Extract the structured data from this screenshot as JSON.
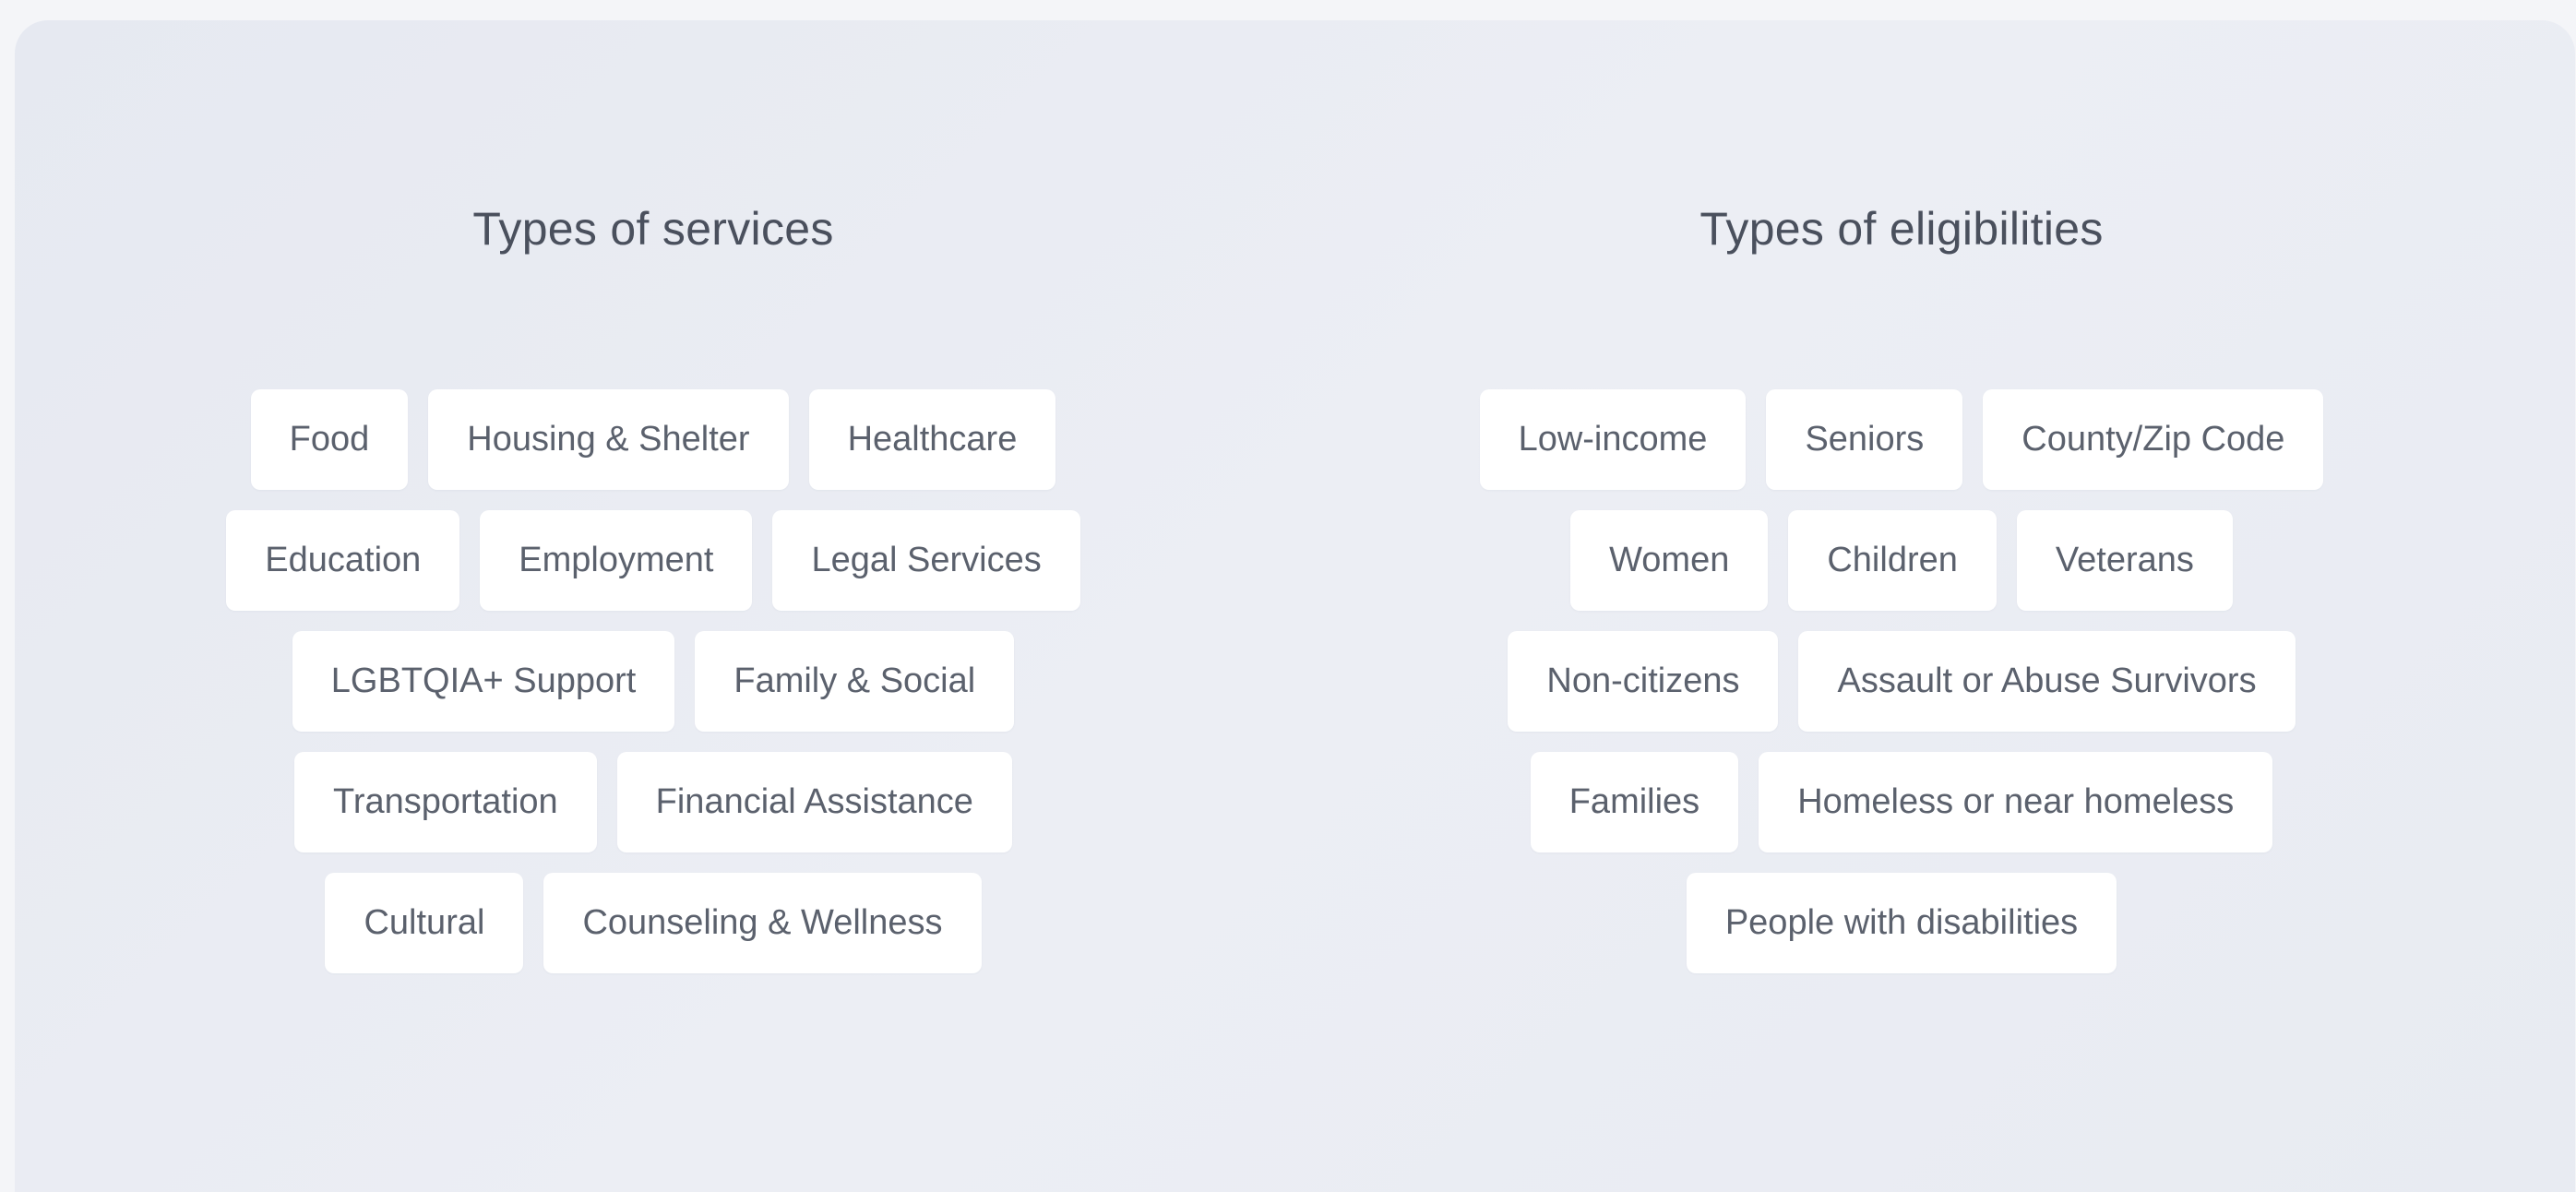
{
  "services": {
    "title": "Types of services",
    "rows": [
      [
        {
          "name": "chip-food",
          "label": "Food"
        },
        {
          "name": "chip-housing-shelter",
          "label": "Housing & Shelter"
        },
        {
          "name": "chip-healthcare",
          "label": "Healthcare"
        }
      ],
      [
        {
          "name": "chip-education",
          "label": "Education"
        },
        {
          "name": "chip-employment",
          "label": "Employment"
        },
        {
          "name": "chip-legal-services",
          "label": "Legal Services"
        }
      ],
      [
        {
          "name": "chip-lgbtqia-support",
          "label": "LGBTQIA+ Support"
        },
        {
          "name": "chip-family-social",
          "label": "Family & Social"
        }
      ],
      [
        {
          "name": "chip-transportation",
          "label": "Transportation"
        },
        {
          "name": "chip-financial-assistance",
          "label": "Financial Assistance"
        }
      ],
      [
        {
          "name": "chip-cultural",
          "label": "Cultural"
        },
        {
          "name": "chip-counseling-wellness",
          "label": "Counseling & Wellness"
        }
      ]
    ]
  },
  "eligibilities": {
    "title": "Types of eligibilities",
    "rows": [
      [
        {
          "name": "chip-low-income",
          "label": "Low-income"
        },
        {
          "name": "chip-seniors",
          "label": "Seniors"
        },
        {
          "name": "chip-county-zip-code",
          "label": "County/Zip Code"
        }
      ],
      [
        {
          "name": "chip-women",
          "label": "Women"
        },
        {
          "name": "chip-children",
          "label": "Children"
        },
        {
          "name": "chip-veterans",
          "label": "Veterans"
        }
      ],
      [
        {
          "name": "chip-non-citizens",
          "label": "Non-citizens"
        },
        {
          "name": "chip-assault-abuse-survivors",
          "label": "Assault or Abuse Survivors"
        }
      ],
      [
        {
          "name": "chip-families",
          "label": "Families"
        },
        {
          "name": "chip-homeless",
          "label": "Homeless or near homeless"
        }
      ],
      [
        {
          "name": "chip-people-with-disabilities",
          "label": "People with disabilities"
        }
      ]
    ]
  }
}
